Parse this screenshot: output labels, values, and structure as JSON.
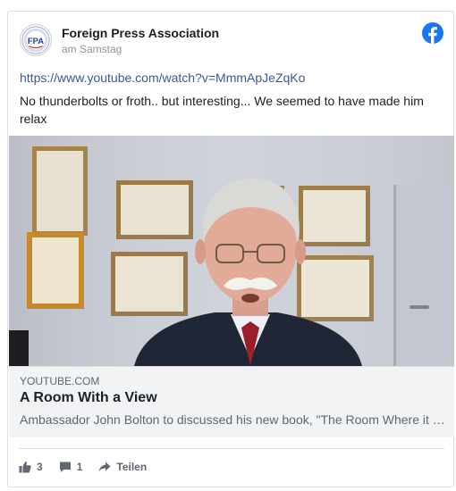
{
  "post": {
    "page_name": "Foreign Press Association",
    "avatar_text": "FPA",
    "timestamp": "am Samstag",
    "link_url": "https://www.youtube.com/watch?v=MmmApJeZqKo",
    "text": "No thunderbolts or froth.. but interesting... We seemed to have made him relax"
  },
  "preview": {
    "domain": "YOUTUBE.COM",
    "title": "A Room With a View",
    "description": "Ambassador John Bolton to discussed his new book, \"The Room Where it Happened\"..."
  },
  "actions": {
    "like_count": "3",
    "comment_count": "1",
    "share_label": "Teilen"
  },
  "icons": {
    "avatar": "fpa-logo-icon",
    "brand": "facebook-icon",
    "like": "thumbs-up-icon",
    "comment": "comment-icon",
    "share": "share-arrow-icon"
  },
  "colors": {
    "facebook_blue": "#1877f2",
    "link": "#385898",
    "muted": "#606770"
  }
}
